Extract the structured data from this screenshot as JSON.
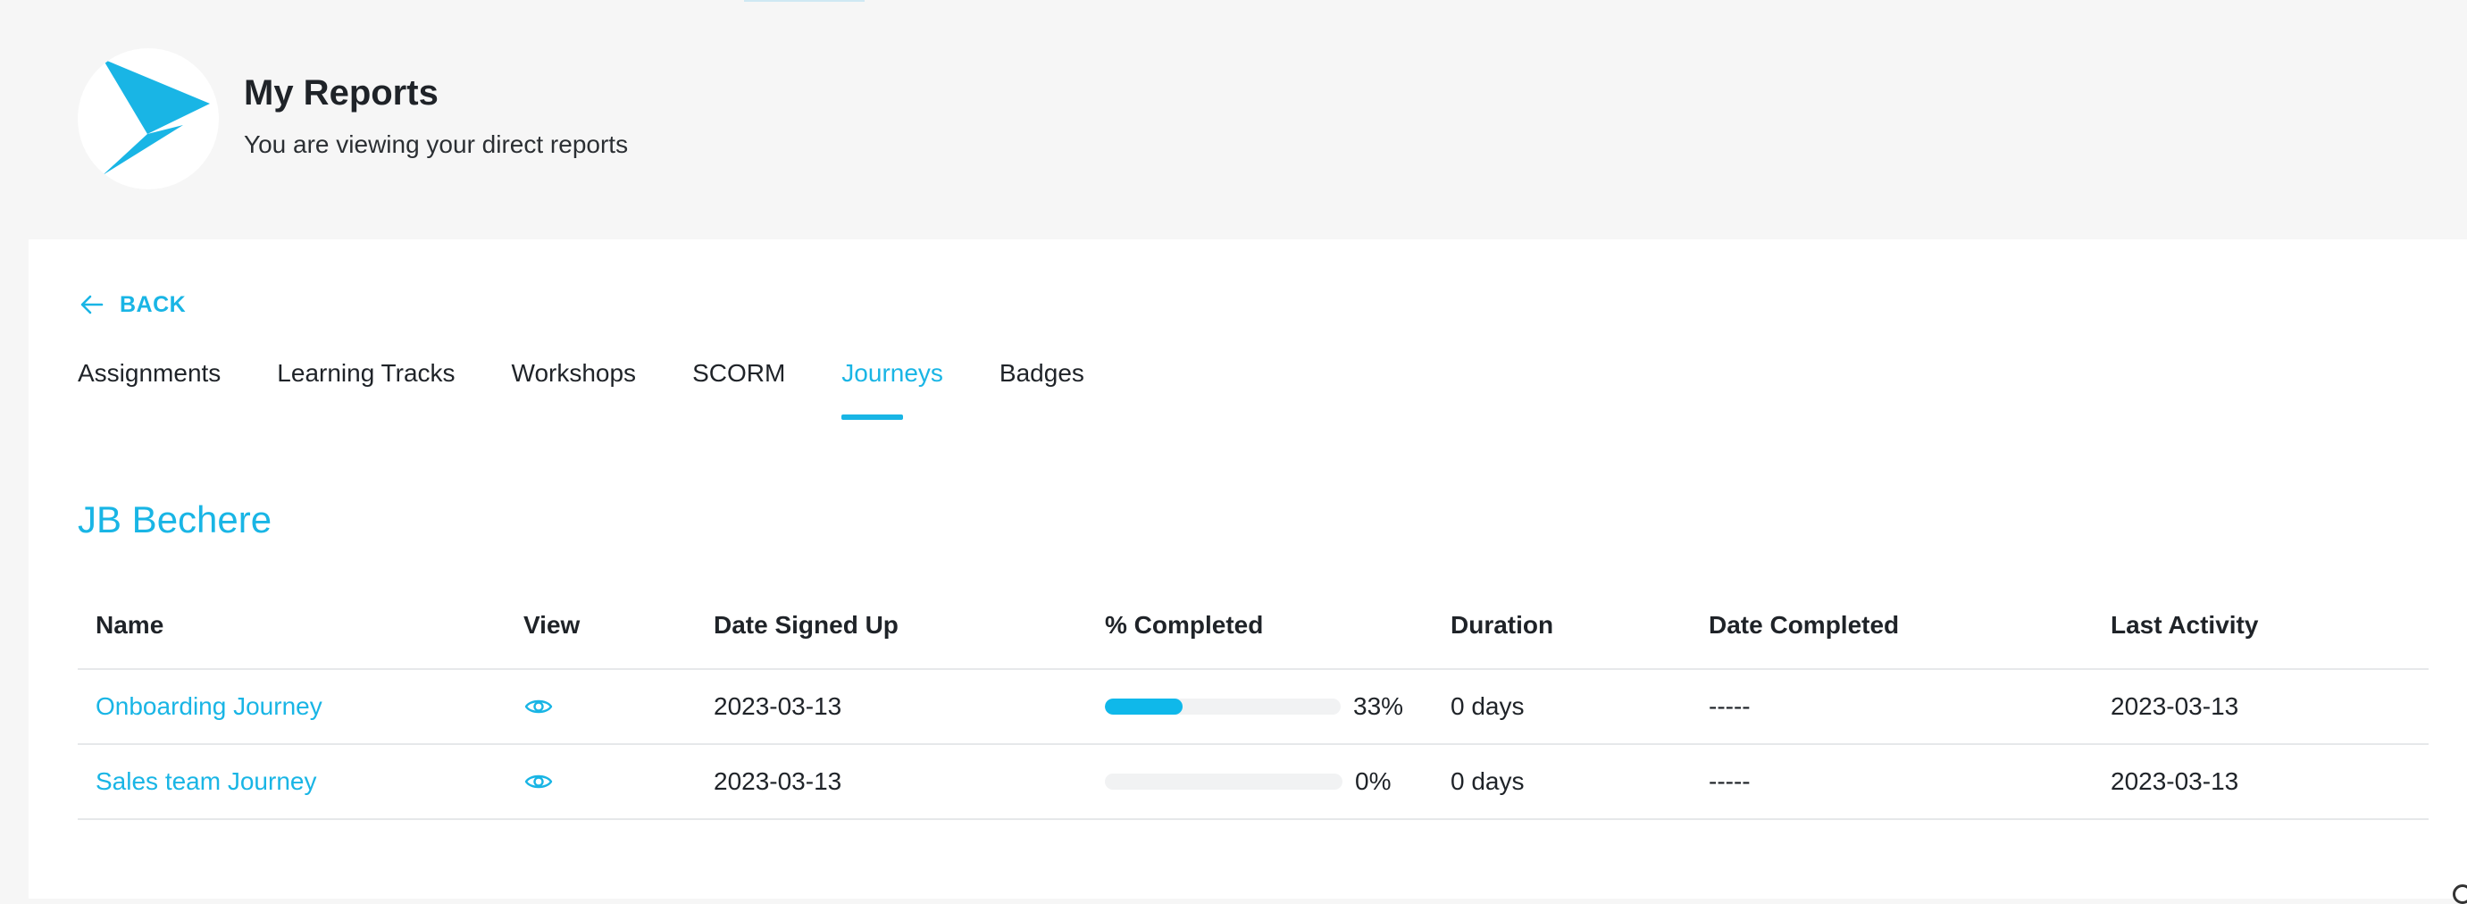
{
  "header": {
    "title": "My Reports",
    "subtitle": "You are viewing your direct reports",
    "logo_icon": "paper-plane-logo",
    "accent_color": "#19b5e5"
  },
  "back": {
    "label": "BACK",
    "icon": "arrow-left-icon"
  },
  "tabs": [
    {
      "label": "Assignments",
      "active": false
    },
    {
      "label": "Learning Tracks",
      "active": false
    },
    {
      "label": "Workshops",
      "active": false
    },
    {
      "label": "SCORM",
      "active": false
    },
    {
      "label": "Journeys",
      "active": true
    },
    {
      "label": "Badges",
      "active": false
    }
  ],
  "learner": {
    "name": "JB Bechere"
  },
  "table": {
    "columns": [
      "Name",
      "View",
      "Date Signed Up",
      "% Completed",
      "Duration",
      "Date Completed",
      "Last Activity"
    ],
    "rows": [
      {
        "name": "Onboarding Journey",
        "view_icon": "eye-icon",
        "date_signed_up": "2023-03-13",
        "percent_completed": "33%",
        "progress": 0.33,
        "duration": "0 days",
        "date_completed": "-----",
        "last_activity": "2023-03-13"
      },
      {
        "name": "Sales team Journey",
        "view_icon": "eye-icon",
        "date_signed_up": "2023-03-13",
        "percent_completed": "0%",
        "progress": 0,
        "duration": "0 days",
        "date_completed": "-----",
        "last_activity": "2023-03-13"
      }
    ]
  }
}
